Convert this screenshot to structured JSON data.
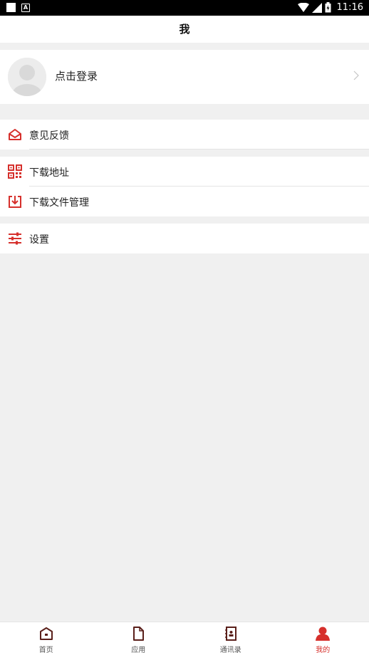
{
  "status_bar": {
    "time": "11:16"
  },
  "header": {
    "title": "我"
  },
  "profile": {
    "login_label": "点击登录"
  },
  "menu": {
    "feedback": "意见反馈",
    "download_address": "下载地址",
    "download_manager": "下载文件管理",
    "settings": "设置"
  },
  "tabs": [
    {
      "label": "首页",
      "icon": "home-icon"
    },
    {
      "label": "应用",
      "icon": "document-icon"
    },
    {
      "label": "通讯录",
      "icon": "contacts-icon"
    },
    {
      "label": "我的",
      "icon": "person-icon"
    }
  ],
  "colors": {
    "accent": "#d6302c",
    "background": "#f0f0f0",
    "icon_dark": "#5a1f1a"
  }
}
